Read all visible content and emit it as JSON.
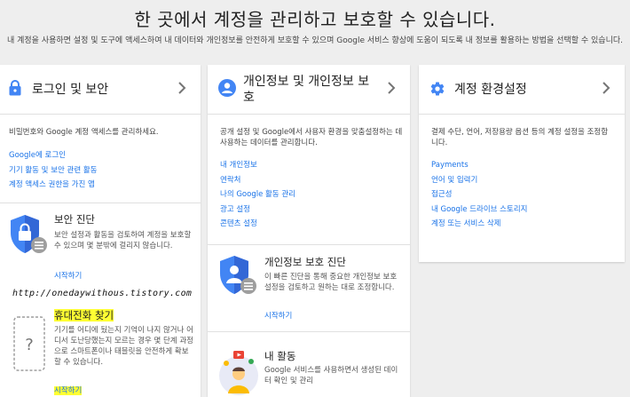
{
  "header": {
    "title": "한 곳에서 계정을 관리하고 보호할 수 있습니다.",
    "subtitle": "내 계정을 사용하면 설정 및 도구에 액세스하여 내 데이터와 개인정보를 안전하게 보호할 수 있으며 Google 서비스 향상에 도움이 되도록 내 정보를 활용하는 방법을 선택할 수 있습니다."
  },
  "watermark": "http://onedaywithous.tistory.com",
  "cards": {
    "login": {
      "title": "로그인 및 보안",
      "description": "비밀번호와 Google 계정 액세스를 관리하세요.",
      "links": [
        "Google에 로그인",
        "기기 활동 및 보안 관련 활동",
        "계정 액세스 권한을 가진 앱"
      ],
      "security_check": {
        "title": "보안 진단",
        "description": "보안 설정과 활동을 검토하여 계정을 보호할 수 있으며 몇 분밖에 걸리지 않습니다.",
        "start": "시작하기"
      },
      "find_phone": {
        "title": "휴대전화 찾기",
        "description": "기기를 어디에 뒀는지 기억이 나지 않거나 어디서 도난당했는지 모르는 경우 몇 단계 과정으로 스마트폰이나 태블릿을 안전하게 확보할 수 있습니다.",
        "start": "시작하기"
      }
    },
    "privacy": {
      "title": "개인정보 및 개인정보 보호",
      "description": "공개 설정 및 Google에서 사용자 환경을 맞춤설정하는 데 사용하는 데이터를 관리합니다.",
      "links": [
        "내 개인정보",
        "연락처",
        "나의 Google 활동 관리",
        "광고 설정",
        "콘텐츠 설정"
      ],
      "privacy_check": {
        "title": "개인정보 보호 진단",
        "description": "이 빠른 진단을 통해 중요한 개인정보 보호 설정을 검토하고 원하는 대로 조정합니다.",
        "start": "시작하기"
      },
      "my_activity": {
        "title": "내 활동",
        "description": "Google 서비스를 사용하면서 생성된 데이터 확인 및 관리"
      }
    },
    "preferences": {
      "title": "계정 환경설정",
      "description": "결제 수단, 언어, 저장용량 옵션 등의 계정 설정을 조정합니다.",
      "links": [
        "Payments",
        "언어 및 입력기",
        "접근성",
        "내 Google 드라이브 스토리지",
        "계정 또는 서비스 삭제"
      ]
    }
  },
  "colors": {
    "link": "#1a73e8",
    "brand_blue": "#4285f4",
    "highlight": "#ffff33",
    "background": "#eeeeee"
  }
}
